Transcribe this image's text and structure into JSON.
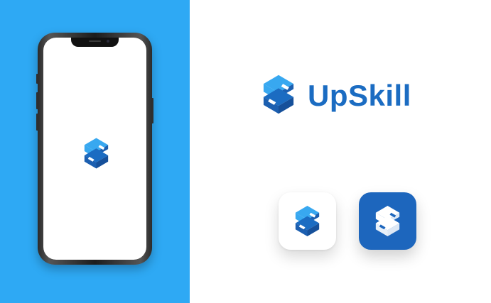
{
  "brand": {
    "name": "UpSkill",
    "logo_icon": "upskill-s-hexagon-icon",
    "colors": {
      "primary": "#1b6cc2",
      "light": "#38a8f0",
      "dark": "#1c5fb0",
      "background_panel": "#2ea9f4",
      "icon_dark_bg": "#1d66bd"
    }
  },
  "mockup": {
    "device": "smartphone",
    "screen_background": "#ffffff"
  },
  "app_icons": [
    {
      "variant": "light",
      "background": "#ffffff"
    },
    {
      "variant": "dark",
      "background": "#1d66bd"
    }
  ]
}
